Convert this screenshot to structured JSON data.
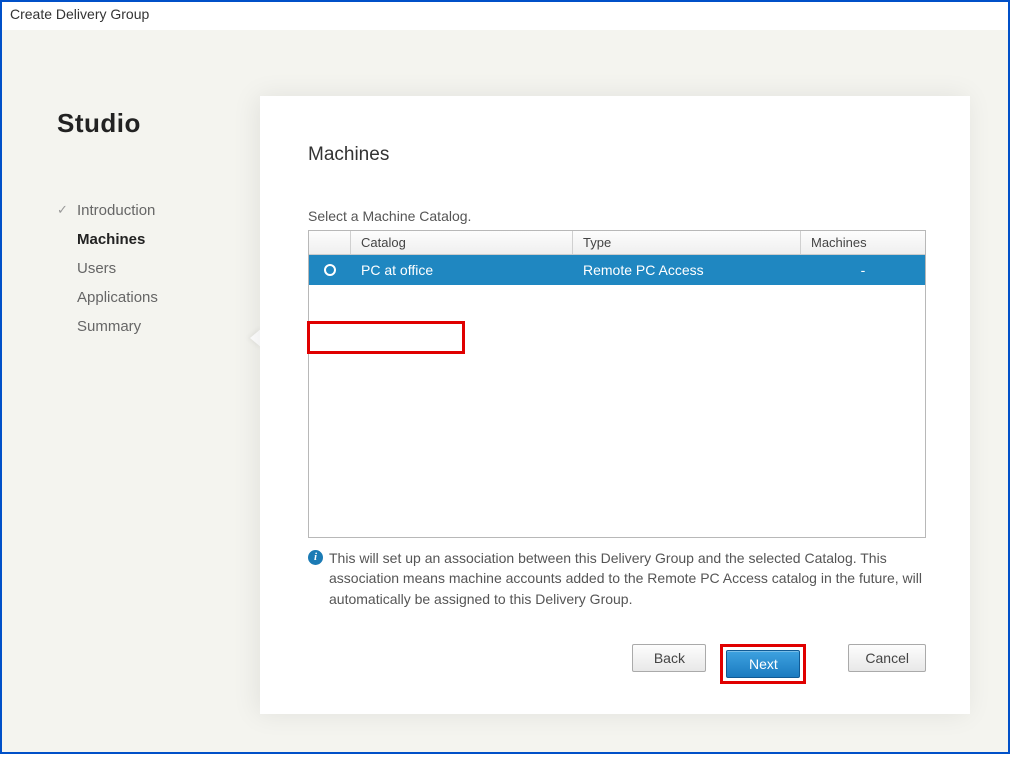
{
  "window": {
    "title": "Create Delivery Group"
  },
  "sidebar": {
    "brand": "Studio",
    "items": [
      {
        "label": "Introduction",
        "state": "completed"
      },
      {
        "label": "Machines",
        "state": "active"
      },
      {
        "label": "Users",
        "state": ""
      },
      {
        "label": "Applications",
        "state": ""
      },
      {
        "label": "Summary",
        "state": ""
      }
    ]
  },
  "panel": {
    "title": "Machines",
    "instruction": "Select a Machine Catalog.",
    "table": {
      "headers": {
        "catalog": "Catalog",
        "type": "Type",
        "machines": "Machines"
      },
      "rows": [
        {
          "catalog": "PC at office",
          "type": "Remote PC Access",
          "machines": "-",
          "selected": true
        }
      ]
    },
    "info": "This will set up an association between this Delivery Group and the selected Catalog. This association means machine accounts added to the Remote PC Access catalog in the future, will automatically be assigned to this Delivery Group."
  },
  "buttons": {
    "back": "Back",
    "next": "Next",
    "cancel": "Cancel"
  }
}
